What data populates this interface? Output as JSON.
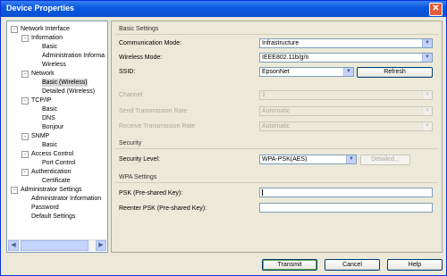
{
  "window": {
    "title": "Device Properties"
  },
  "tree": [
    {
      "label": "Network Interface",
      "indent": 0,
      "expander": "-"
    },
    {
      "label": "Information",
      "indent": 1,
      "expander": "-"
    },
    {
      "label": "Basic",
      "indent": 2
    },
    {
      "label": "Administration Informa",
      "indent": 2
    },
    {
      "label": "Wireless",
      "indent": 2
    },
    {
      "label": "Network",
      "indent": 1,
      "expander": "-"
    },
    {
      "label": "Basic (Wireless)",
      "indent": 2,
      "selected": true
    },
    {
      "label": "Detailed (Wireless)",
      "indent": 2
    },
    {
      "label": "TCP/IP",
      "indent": 1,
      "expander": "-"
    },
    {
      "label": "Basic",
      "indent": 2
    },
    {
      "label": "DNS",
      "indent": 2
    },
    {
      "label": "Bonjour",
      "indent": 2
    },
    {
      "label": "SNMP",
      "indent": 1,
      "expander": "-"
    },
    {
      "label": "Basic",
      "indent": 2
    },
    {
      "label": "Access Control",
      "indent": 1,
      "expander": "-"
    },
    {
      "label": "Port Control",
      "indent": 2
    },
    {
      "label": "Authentication",
      "indent": 1,
      "expander": "-"
    },
    {
      "label": "Certificate",
      "indent": 2
    },
    {
      "label": "Administrator Settings",
      "indent": 0,
      "expander": "-"
    },
    {
      "label": "Administrator Information",
      "indent": 1
    },
    {
      "label": "Password",
      "indent": 1
    },
    {
      "label": "Default Settings",
      "indent": 1
    }
  ],
  "basic": {
    "title": "Basic Settings",
    "comm_mode_label": "Communication Mode:",
    "comm_mode_value": "Infrastructure",
    "wireless_mode_label": "Wireless Mode:",
    "wireless_mode_value": "IEEE802.11b/g/n",
    "ssid_label": "SSID:",
    "ssid_value": "EpsonNet",
    "refresh_label": "Refresh",
    "channel_label": "Channel",
    "channel_value": "1",
    "send_rate_label": "Send Transmission Rate",
    "send_rate_value": "Automatic",
    "recv_rate_label": "Receive Transmission Rate",
    "recv_rate_value": "Automatic"
  },
  "security": {
    "title": "Security",
    "level_label": "Security Level:",
    "level_value": "WPA-PSK(AES)",
    "detailed_label": "Detailed..."
  },
  "wpa": {
    "title": "WPA Settings",
    "psk_label": "PSK (Pre-shared Key):",
    "reenter_label": "Reenter PSK (Pre-shared Key):"
  },
  "footer": {
    "transmit": "Transmit",
    "cancel": "Cancel",
    "help": "Help"
  }
}
